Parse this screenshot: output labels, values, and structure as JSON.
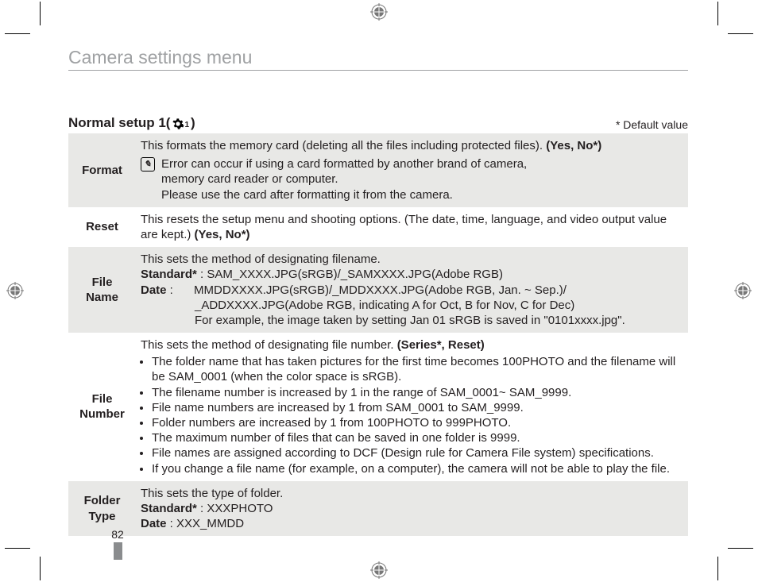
{
  "header": {
    "title": "Camera settings menu"
  },
  "section": {
    "title_prefix": "Normal setup 1(",
    "title_suffix": " )",
    "subscript": "1",
    "default_note": "* Default value"
  },
  "icons": {
    "note_glyph": "✎"
  },
  "rows": {
    "format": {
      "label": "Format",
      "line1_a": "This formats the memory card (deleting all the files including protected files). ",
      "line1_b": "(Yes, No*)",
      "note_l1": "Error can occur if using a card formatted by another brand of camera,",
      "note_l2": "memory card reader or computer.",
      "note_l3": "Please use the card after formatting it from the camera."
    },
    "reset": {
      "label": "Reset",
      "body_a": "This resets the setup menu and shooting options. (The date, time, language, and video output value are kept.) ",
      "body_b": "(Yes, No*)"
    },
    "filename": {
      "label_l1": "File",
      "label_l2": "Name",
      "l1": "This sets the method of designating filename.",
      "l2_a": "Standard*",
      "l2_b": " : SAM_XXXX.JPG(sRGB)/_SAMXXXX.JPG(Adobe RGB)",
      "l3_a": "Date",
      "l3_b": " :",
      "l3_c": "MDDXXXX.JPG(sRGB)/_MDDXXXX.JPG(Adobe RGB, Jan. ~ Sep.)/",
      "l3_c_pref": "M",
      "l4": "_ADDXXXX.JPG(Adobe RGB, indicating A for Oct, B for Nov, C for Dec)",
      "l5": "For example, the image taken by setting Jan 01 sRGB is saved in \"0101xxxx.jpg\"."
    },
    "filenumber": {
      "label_l1": "File",
      "label_l2": "Number",
      "l1_a": "This sets the method of designating file number. ",
      "l1_b": "(Series*, Reset)",
      "b1": "The folder name that has taken pictures for the first time becomes 100PHOTO and the filename will be SAM_0001 (when the color space is sRGB).",
      "b2": "The filename number is increased by 1 in the range of SAM_0001~ SAM_9999.",
      "b3": "File name numbers are increased by 1 from SAM_0001 to SAM_9999.",
      "b4": "Folder numbers are increased by 1 from 100PHOTO to 999PHOTO.",
      "b5": "The maximum number of files that can be saved in one folder is 9999.",
      "b6": "File names are assigned according to DCF (Design rule for Camera File system) specifications.",
      "b7": "If you change a file name (for example, on a computer), the camera will not be able to play the file."
    },
    "foldertype": {
      "label_l1": "Folder",
      "label_l2": "Type",
      "l1": "This sets the type of folder.",
      "l2_a": "Standard*",
      "l2_b": " : XXXPHOTO",
      "l3_a": "Date",
      "l3_b": " : XXX_MMDD"
    }
  },
  "page_number": "82"
}
